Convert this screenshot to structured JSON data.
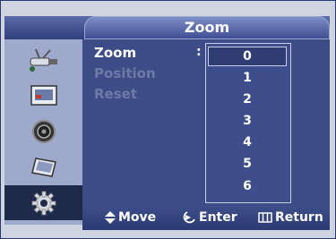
{
  "header": {
    "title": "Zoom"
  },
  "menu": {
    "items": [
      {
        "label": "Zoom"
      },
      {
        "label": "Position"
      },
      {
        "label": "Reset"
      }
    ],
    "colon": ":"
  },
  "dropdown": {
    "options": [
      "0",
      "1",
      "2",
      "3",
      "4",
      "5",
      "6"
    ],
    "selected": "0"
  },
  "sidebar": {
    "icons": [
      "antenna-icon",
      "picture-icon",
      "sound-icon",
      "channel-icon",
      "setup-icon"
    ],
    "active": "setup-icon"
  },
  "footer": {
    "move": "Move",
    "enter": "Enter",
    "return": "Return"
  },
  "colors": {
    "accent": "#3d4c86",
    "header": "#3f4f93",
    "sidebar": "#9ea9cb"
  }
}
